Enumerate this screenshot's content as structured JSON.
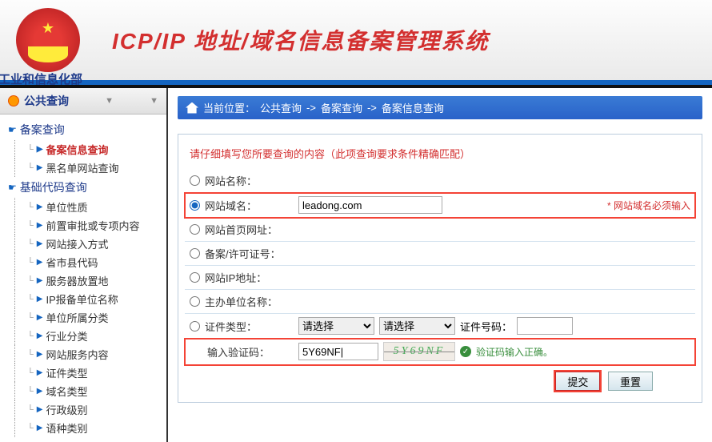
{
  "header": {
    "title": "ICP/IP 地址/域名信息备案管理系统",
    "org": "工业和信息化部"
  },
  "sidebar": {
    "title": "公共查询",
    "groups": [
      {
        "label": "备案查询",
        "items": [
          {
            "label": "备案信息查询",
            "active": true
          },
          {
            "label": "黑名单网站查询"
          }
        ]
      },
      {
        "label": "基础代码查询",
        "items": [
          {
            "label": "单位性质"
          },
          {
            "label": "前置审批或专项内容"
          },
          {
            "label": "网站接入方式"
          },
          {
            "label": "省市县代码"
          },
          {
            "label": "服务器放置地"
          },
          {
            "label": "IP报备单位名称"
          },
          {
            "label": "单位所属分类"
          },
          {
            "label": "行业分类"
          },
          {
            "label": "网站服务内容"
          },
          {
            "label": "证件类型"
          },
          {
            "label": "域名类型"
          },
          {
            "label": "行政级别"
          },
          {
            "label": "语种类别"
          }
        ]
      }
    ]
  },
  "breadcrumb": {
    "prefix": "当前位置：",
    "parts": [
      "公共查询",
      "备案查询",
      "备案信息查询"
    ],
    "sep": "->"
  },
  "form": {
    "instruction": "请仔细填写您所要查询的内容（此项查询要求条件精确匹配）",
    "rows": {
      "siteName": "网站名称：",
      "domain": "网站域名：",
      "homepage": "网站首页网址：",
      "license": "备案/许可证号：",
      "ip": "网站IP地址：",
      "sponsor": "主办单位名称：",
      "certType": "证件类型：",
      "certNo": "证件号码：",
      "captcha": "输入验证码："
    },
    "values": {
      "domain": "leadong.com",
      "captcha": "5Y69NF|"
    },
    "selectPlaceholder": "请选择",
    "captchaImage": "5Y69NF",
    "captchaOk": "验证码输入正确。",
    "domainNote": "* 网站域名必须输入",
    "submit": "提交",
    "reset": "重置"
  }
}
